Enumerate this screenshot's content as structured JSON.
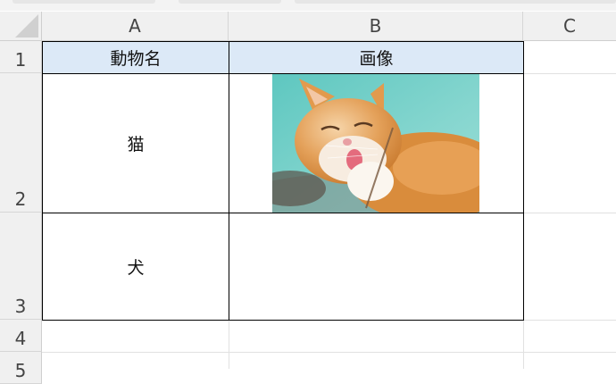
{
  "columns": [
    "A",
    "B",
    "C"
  ],
  "rows": [
    "1",
    "2",
    "3",
    "4",
    "5"
  ],
  "header": {
    "animal_name": "動物名",
    "image": "画像"
  },
  "data_rows": [
    {
      "name": "猫",
      "has_image": true,
      "image_icon": "cat-photo"
    },
    {
      "name": "犬",
      "has_image": false
    }
  ],
  "colors": {
    "header_fill": "#dce9f7",
    "heading_bg": "#f0f0f0",
    "gridline": "#e1e1e1"
  }
}
